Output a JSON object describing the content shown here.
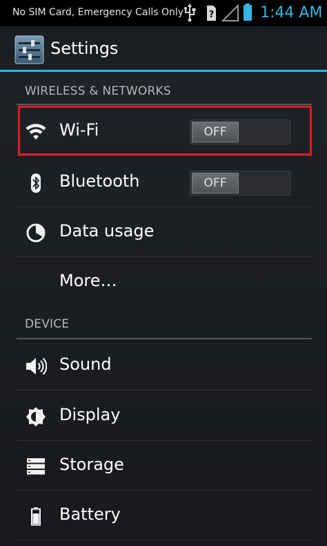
{
  "status_bar": {
    "carrier_text": "No SIM Card, Emergency Calls Only",
    "time": "1:44 AM",
    "icons": [
      "usb-icon",
      "no-sim-icon",
      "signal-icon",
      "battery-icon"
    ]
  },
  "action_bar": {
    "title": "Settings",
    "icon": "settings-sliders-icon",
    "accent_color": "#33b5e5"
  },
  "sections": [
    {
      "header": "WIRELESS & NETWORKS",
      "items": [
        {
          "label": "Wi-Fi",
          "icon": "wifi-icon",
          "toggle": "OFF",
          "highlighted": true
        },
        {
          "label": "Bluetooth",
          "icon": "bluetooth-icon",
          "toggle": "OFF"
        },
        {
          "label": "Data usage",
          "icon": "data-usage-icon"
        },
        {
          "label": "More…"
        }
      ]
    },
    {
      "header": "DEVICE",
      "items": [
        {
          "label": "Sound",
          "icon": "speaker-icon"
        },
        {
          "label": "Display",
          "icon": "brightness-icon"
        },
        {
          "label": "Storage",
          "icon": "storage-icon"
        },
        {
          "label": "Battery",
          "icon": "battery-icon"
        }
      ]
    }
  ],
  "highlight_color": "#e21c2b"
}
